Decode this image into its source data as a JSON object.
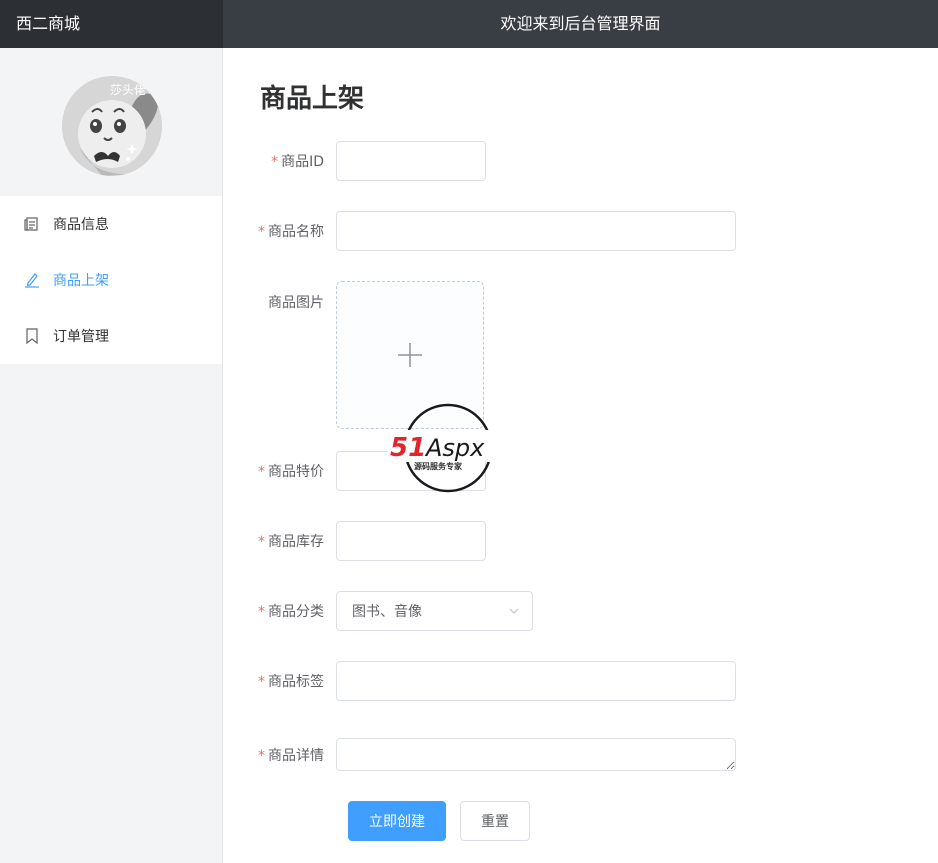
{
  "header": {
    "brand": "西二商城",
    "welcome": "欢迎来到后台管理界面"
  },
  "sidebar": {
    "avatar_text": "莎头佬",
    "items": [
      {
        "label": "商品信息",
        "icon": "document-icon",
        "active": false
      },
      {
        "label": "商品上架",
        "icon": "edit-icon",
        "active": true
      },
      {
        "label": "订单管理",
        "icon": "bookmark-icon",
        "active": false
      }
    ]
  },
  "main": {
    "title": "商品上架",
    "fields": {
      "id": {
        "label": "商品ID",
        "required": true,
        "value": ""
      },
      "name": {
        "label": "商品名称",
        "required": true,
        "value": ""
      },
      "image": {
        "label": "商品图片",
        "required": false
      },
      "price": {
        "label": "商品特价",
        "required": true,
        "value": ""
      },
      "stock": {
        "label": "商品库存",
        "required": true,
        "value": ""
      },
      "category": {
        "label": "商品分类",
        "required": true,
        "value": "图书、音像"
      },
      "tags": {
        "label": "商品标签",
        "required": true,
        "value": ""
      },
      "detail": {
        "label": "商品详情",
        "required": true,
        "value": ""
      }
    },
    "buttons": {
      "create": "立即创建",
      "reset": "重置"
    },
    "required_mark": "*"
  },
  "watermark": {
    "brand_red": "51",
    "brand_rest": "Aspx",
    "subtitle": "源码服务专家"
  },
  "colors": {
    "accent": "#409eff",
    "required": "#f56c6c",
    "header": "#393d44"
  }
}
